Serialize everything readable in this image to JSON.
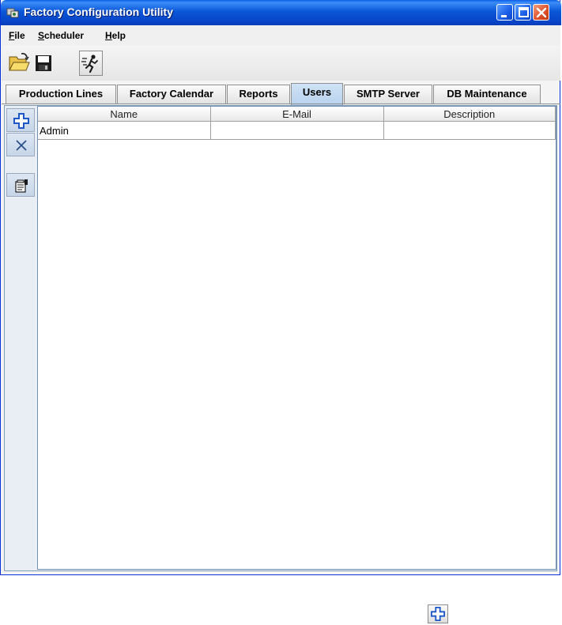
{
  "window": {
    "title": "Factory Configuration Utility"
  },
  "menu": {
    "file": {
      "mnemonic": "F",
      "rest": "ile"
    },
    "scheduler": {
      "mnemonic": "S",
      "rest": "cheduler"
    },
    "help": {
      "mnemonic": "H",
      "rest": "elp"
    }
  },
  "toolbar": {
    "icons": [
      "open-folder-icon",
      "save-disk-icon",
      "run-icon"
    ]
  },
  "tabs": [
    {
      "label": "Production Lines",
      "active": false
    },
    {
      "label": "Factory Calendar",
      "active": false
    },
    {
      "label": "Reports",
      "active": false
    },
    {
      "label": "Users",
      "active": true
    },
    {
      "label": "SMTP Server",
      "active": false
    },
    {
      "label": "DB Maintenance",
      "active": false
    }
  ],
  "side_toolbar": {
    "icons": [
      "add-icon",
      "delete-icon",
      "properties-icon"
    ]
  },
  "users_table": {
    "columns": [
      "Name",
      "E-Mail",
      "Description"
    ],
    "rows": [
      [
        "Admin",
        "",
        ""
      ]
    ]
  },
  "colors": {
    "titlebar": "#0a57d8",
    "active_tab": "#b8d2ee",
    "add_icon_blue": "#1c57c9"
  }
}
